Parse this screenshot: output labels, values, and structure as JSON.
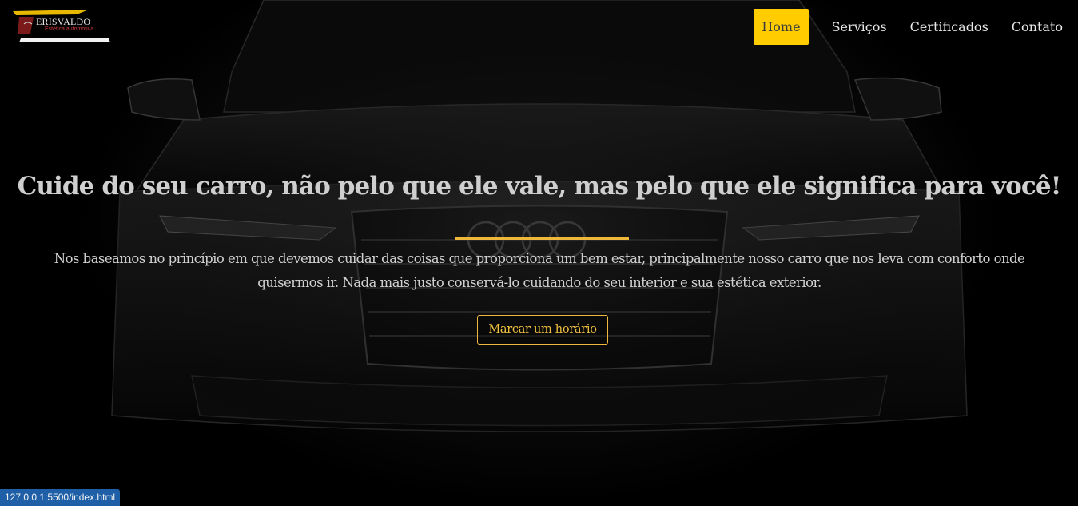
{
  "brand": {
    "name": "ERISVALDO",
    "subtitle": "Estética automotiva",
    "accent": "#ffcc00",
    "subtitle_color": "#d23a3a"
  },
  "nav": {
    "items": [
      {
        "label": "Home",
        "active": true
      },
      {
        "label": "Serviços",
        "active": false
      },
      {
        "label": "Certificados",
        "active": false
      },
      {
        "label": "Contato",
        "active": false
      }
    ]
  },
  "hero": {
    "headline": "Cuide do seu carro, não pelo que ele vale, mas pelo que ele significa para você!",
    "text": "Nos baseamos no princípio em que devemos cuidar das coisas que proporciona um bem estar, principalmente nosso carro que nos leva com conforto onde quisermos ir. Nada mais justo conservá-lo cuidando do seu interior e sua estética exterior.",
    "cta_label": "Marcar um horário",
    "divider_color": "#f0b83a",
    "background": "dark-car-front-image"
  },
  "status_bar": {
    "url": "127.0.0.1:5500/index.html",
    "color": "#1e5fa8"
  }
}
